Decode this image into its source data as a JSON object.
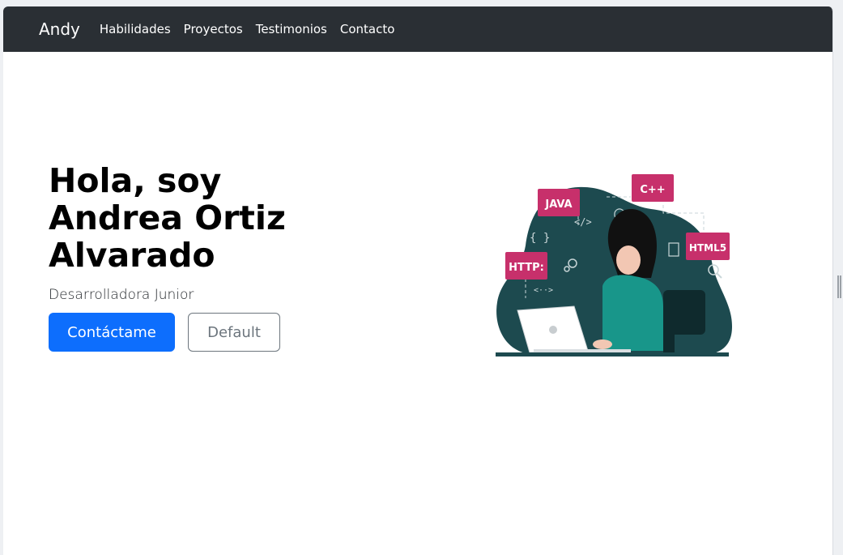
{
  "navbar": {
    "brand": "Andy",
    "links": [
      "Habilidades",
      "Proyectos",
      "Testimonios",
      "Contacto"
    ]
  },
  "hero": {
    "title": "Hola, soy Andrea Ortiz Alvarado",
    "subtitle": "Desarrolladora Junior",
    "primary_button": "Contáctame",
    "secondary_button": "Default"
  },
  "illustration": {
    "tags": [
      "JAVA",
      "C++",
      "HTTP:",
      "HTML5"
    ],
    "colors": {
      "blob": "#1d4a4f",
      "tag": "#c7306b",
      "shirt": "#18968a"
    }
  },
  "colors": {
    "navbar_bg": "#2a2f34",
    "primary": "#0d6efd",
    "outline": "#6c757d"
  }
}
